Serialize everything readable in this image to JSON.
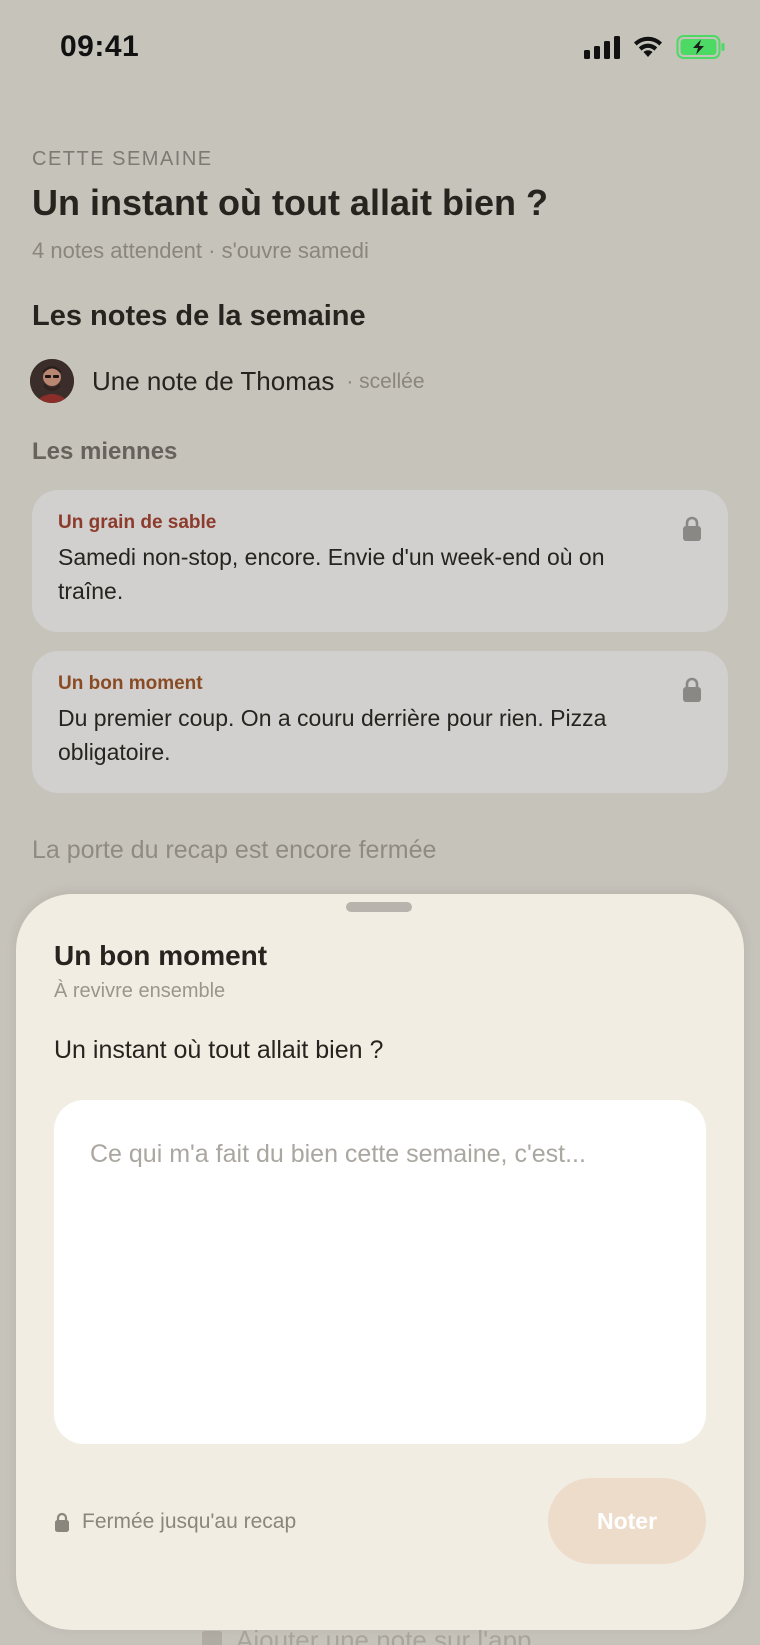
{
  "status_bar": {
    "time": "09:41"
  },
  "header": {
    "kicker": "CETTE SEMAINE",
    "title": "Un instant où tout allait bien ?",
    "subtitle": "4 notes attendent · s'ouvre samedi"
  },
  "week_notes": {
    "heading": "Les notes de la semaine",
    "friend_note": {
      "name": "Une note de Thomas",
      "status": "· scellée"
    }
  },
  "mine": {
    "heading": "Les miennes",
    "notes": [
      {
        "label": "Un grain de sable",
        "text": "Samedi non-stop, encore. Envie d'un week-end où on traîne.",
        "icon": "lock-icon"
      },
      {
        "label": "Un bon moment",
        "text": "Du premier coup. On a couru derrière pour rien. Pizza obligatoire.",
        "icon": "lock-icon"
      }
    ]
  },
  "door_text": "La porte du recap est encore fermée",
  "behind_hint": "Ajouter une note sur l'app",
  "sheet": {
    "title": "Un bon moment",
    "subtitle": "À revivre ensemble",
    "prompt": "Un instant où tout allait bien ?",
    "input_placeholder": "Ce qui m'a fait du bien cette semaine, c'est...",
    "input_value": "",
    "sealed_text": "Fermée jusqu'au recap",
    "submit_label": "Noter"
  },
  "colors": {
    "background": "#c6c3bb",
    "sheet": "#f2ede3",
    "card": "#d1d0ce",
    "label_sand": "#8c3b2c",
    "label_moment": "#8a4b24",
    "button_disabled": "#eedccb",
    "battery": "#4cd964"
  }
}
